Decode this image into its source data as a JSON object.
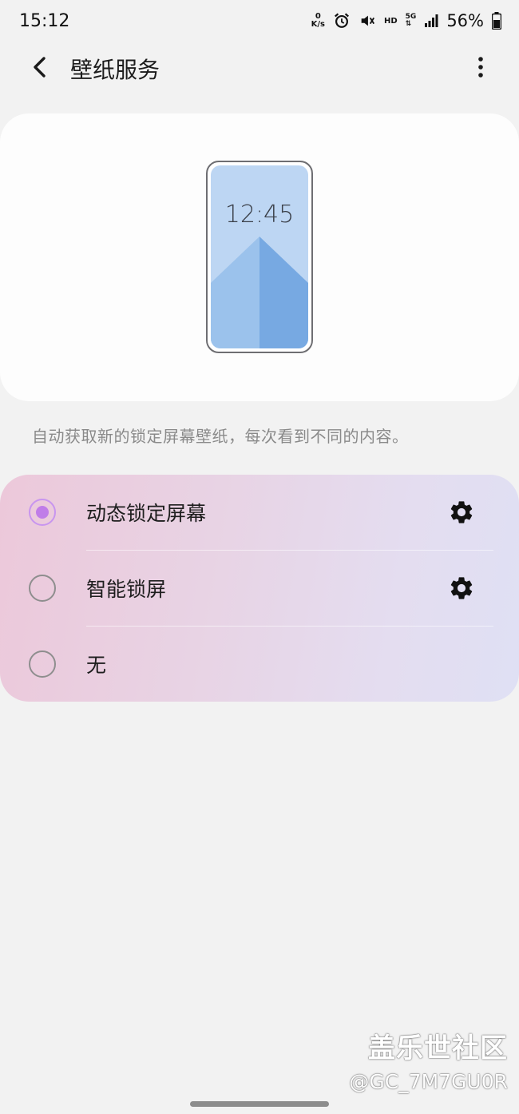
{
  "status_bar": {
    "time": "15:12",
    "net_speed_value": "0",
    "net_speed_unit": "K/s",
    "hd_label": "HD",
    "network_label": "5G",
    "battery_percent": "56%",
    "icons": [
      "alarm-icon",
      "mute-icon",
      "signal-icon",
      "battery-icon"
    ]
  },
  "header": {
    "title": "壁纸服务",
    "back_icon": "back-arrow-icon",
    "more_icon": "more-vert-icon"
  },
  "preview": {
    "clock": "12:45",
    "colors": {
      "sky": "#bdd6f3",
      "mountain_left": "#9bc2ec",
      "mountain_right": "#77a9e2"
    }
  },
  "description": "自动获取新的锁定屏幕壁纸，每次看到不同的内容。",
  "options": [
    {
      "label": "动态锁定屏幕",
      "selected": true,
      "has_settings": true
    },
    {
      "label": "智能锁屏",
      "selected": false,
      "has_settings": true
    },
    {
      "label": "无",
      "selected": false,
      "has_settings": false
    }
  ],
  "watermark": {
    "brand": "盖乐世社区",
    "user": "@GC_7M7GU0R"
  },
  "colors": {
    "accent": "#c07de8",
    "background": "#f2f2f2"
  }
}
